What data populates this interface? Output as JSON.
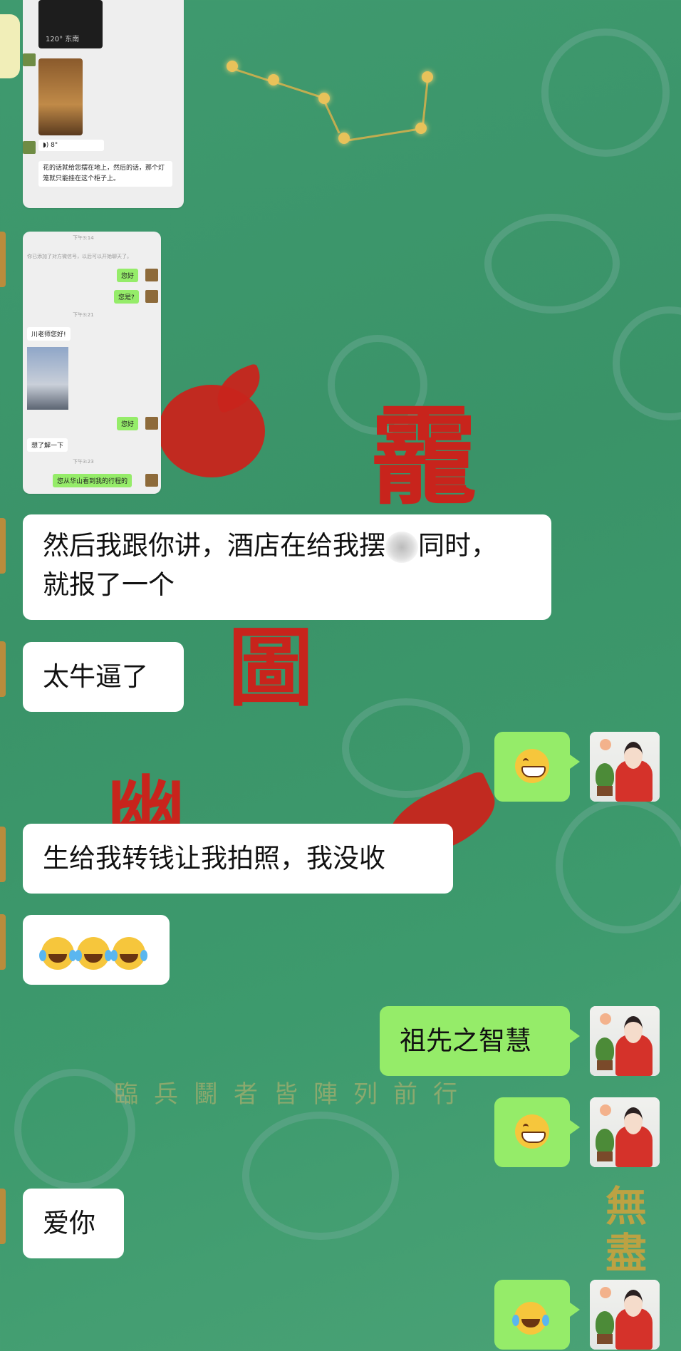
{
  "screenshot1": {
    "compass_text": "120° 东南",
    "voice_duration": "8\"",
    "message": "花的话就给您摆在地上，然后的话，那个灯笼就只能挂在这个柜子上。"
  },
  "screenshot2": {
    "time1": "下午3:14",
    "system_note": "你已添加了对方微信号，以后可以开始聊天了。",
    "msg1": "您好",
    "msg2": "您是?",
    "time2": "下午3:21",
    "msg3": "川老师您好!",
    "msg4": "您好",
    "msg5": "想了解一下",
    "time3": "下午3:23",
    "msg6": "您从华山看到我的行程的"
  },
  "messages": [
    {
      "text": "然后我跟你讲，酒店在给我摆",
      "text2": "同时，",
      "text3": "就报了一个"
    },
    {
      "text": "太牛逼了"
    },
    {
      "text": "生给我转钱让我拍照，我没收"
    },
    {
      "text": "祖先之智慧"
    },
    {
      "text": "爱你"
    }
  ],
  "background": {
    "banner_text": "臨兵鬭者皆陣列前行",
    "gold_chars": "無盡"
  },
  "colors": {
    "background": "#3f9a6f",
    "incoming_bubble": "#ffffff",
    "outgoing_bubble": "#95ec69"
  }
}
